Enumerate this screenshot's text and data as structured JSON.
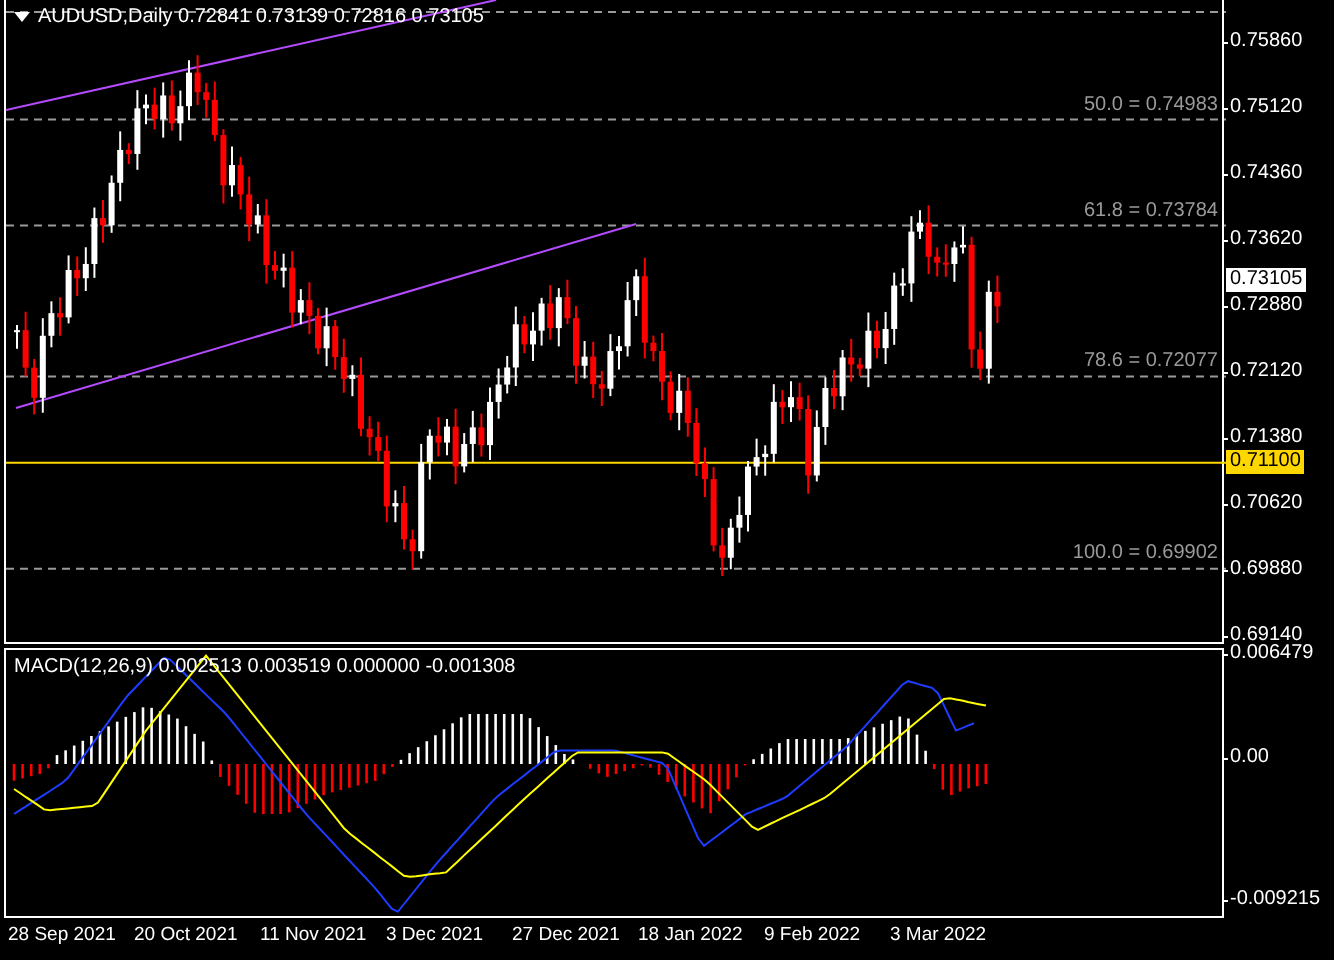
{
  "header": {
    "title": "AUDUSD,Daily 0.72841 0.73139 0.72816 0.73105"
  },
  "fib_levels": [
    {
      "label": "50.0 = 0.74983"
    },
    {
      "label": "61.8 = 0.73784"
    },
    {
      "label": "78.6 = 0.72077"
    },
    {
      "label": "100.0 = 0.69902"
    }
  ],
  "price_axis": {
    "ticks": [
      "0.75860",
      "0.75120",
      "0.74360",
      "0.73620",
      "0.72880",
      "0.72120",
      "0.71380",
      "0.70620",
      "0.69880",
      "0.69140"
    ]
  },
  "price_tags": [
    {
      "label": "0.73105",
      "kind": "bid"
    },
    {
      "label": "0.71100",
      "kind": "level"
    }
  ],
  "macd": {
    "title": "MACD(12,26,9) 0.002513 0.003519 0.000000 -0.001308",
    "axis_ticks": [
      "0.006479",
      "0.00",
      "-0.009215"
    ]
  },
  "date_axis": [
    "28 Sep 2021",
    "20 Oct 2021",
    "11 Nov 2021",
    "3 Dec 2021",
    "27 Dec 2021",
    "18 Jan 2022",
    "9 Feb 2022",
    "3 Mar 2022"
  ]
}
